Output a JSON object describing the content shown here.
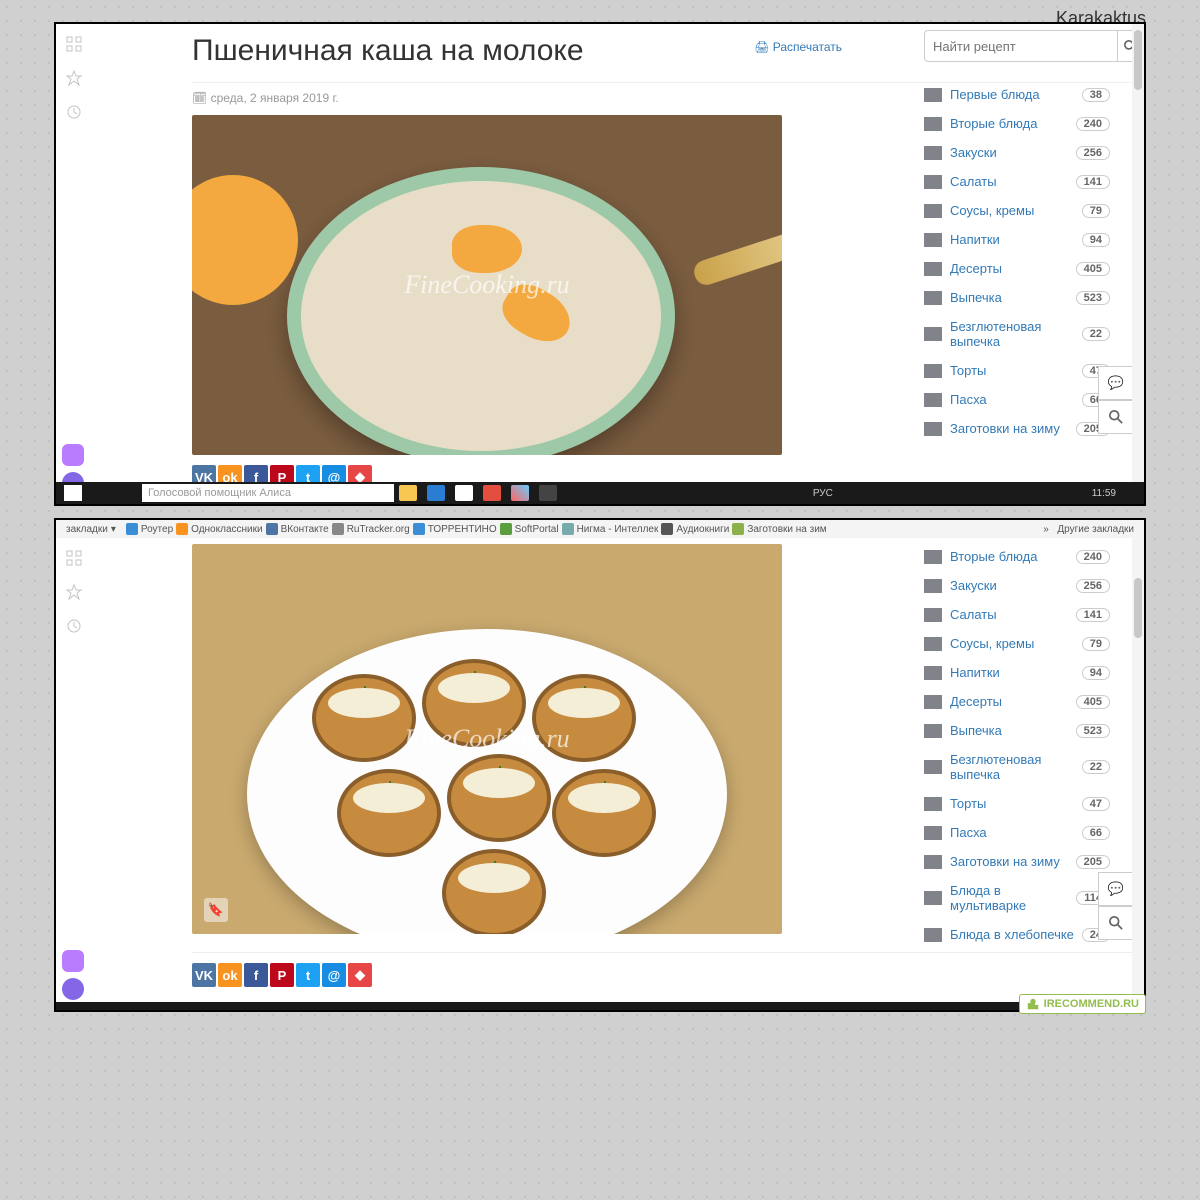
{
  "author": "Karakaktus",
  "shot1": {
    "title": "Пшеничная каша на молоке",
    "print": "Распечатать",
    "date": "среда, 2 января 2019 г.",
    "watermark": "FineCooking.ru",
    "search_placeholder": "Найти рецепт",
    "taskbar_search": "Голосовой помощник Алиса",
    "lang": "РУС",
    "time": "11:59",
    "categories": [
      {
        "name": "Первые блюда",
        "count": "38"
      },
      {
        "name": "Вторые блюда",
        "count": "240"
      },
      {
        "name": "Закуски",
        "count": "256"
      },
      {
        "name": "Салаты",
        "count": "141"
      },
      {
        "name": "Соусы, кремы",
        "count": "79"
      },
      {
        "name": "Напитки",
        "count": "94"
      },
      {
        "name": "Десерты",
        "count": "405"
      },
      {
        "name": "Выпечка",
        "count": "523"
      },
      {
        "name": "Безглютеновая выпечка",
        "count": "22"
      },
      {
        "name": "Торты",
        "count": "47"
      },
      {
        "name": "Пасха",
        "count": "66"
      },
      {
        "name": "Заготовки на зиму",
        "count": "205"
      }
    ]
  },
  "shot2": {
    "watermark": "FineCooking.ru",
    "bookmarks_label": "закладки",
    "other_bookmarks": "Другие закладки",
    "bookmarks": [
      {
        "name": "Роутер",
        "c": "#3b8dd6"
      },
      {
        "name": "Одноклассники",
        "c": "#f7931e"
      },
      {
        "name": "ВКонтакте",
        "c": "#4c75a3"
      },
      {
        "name": "RuTracker.org",
        "c": "#888"
      },
      {
        "name": "ТОРРЕНТИНО",
        "c": "#3b8dd6"
      },
      {
        "name": "SoftPortal",
        "c": "#5a9e3e"
      },
      {
        "name": "Нигма - Интеллек",
        "c": "#7aa"
      },
      {
        "name": "Аудиокниги",
        "c": "#555"
      },
      {
        "name": "Заготовки на зим",
        "c": "#8ab14a"
      }
    ],
    "categories": [
      {
        "name": "Вторые блюда",
        "count": "240"
      },
      {
        "name": "Закуски",
        "count": "256"
      },
      {
        "name": "Салаты",
        "count": "141"
      },
      {
        "name": "Соусы, кремы",
        "count": "79"
      },
      {
        "name": "Напитки",
        "count": "94"
      },
      {
        "name": "Десерты",
        "count": "405"
      },
      {
        "name": "Выпечка",
        "count": "523"
      },
      {
        "name": "Безглютеновая выпечка",
        "count": "22"
      },
      {
        "name": "Торты",
        "count": "47"
      },
      {
        "name": "Пасха",
        "count": "66"
      },
      {
        "name": "Заготовки на зиму",
        "count": "205"
      },
      {
        "name": "Блюда в мультиварке",
        "count": "114"
      },
      {
        "name": "Блюда в хлебопечке",
        "count": "24"
      }
    ]
  },
  "share_colors": [
    "#4c75a3",
    "#f7931e",
    "#3b5998",
    "#bd081c",
    "#1da1f2",
    "#168de2",
    "#e64646"
  ],
  "irecommend": "IRECOMMEND.RU"
}
